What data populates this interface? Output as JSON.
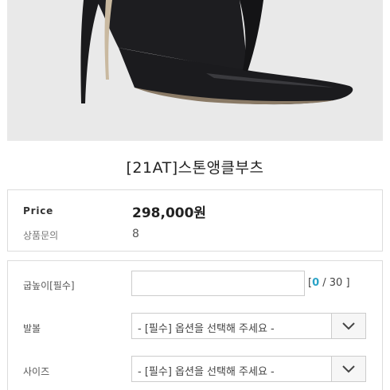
{
  "product": {
    "title": "[21AT]스톤앵클부츠",
    "image_name": "black-stiletto-ankle-boot"
  },
  "info": {
    "price_label": "Price",
    "price_value": "298,000원",
    "qna_label": "상품문의",
    "qna_value": "8"
  },
  "options": {
    "heel_label": "굽높이[필수]",
    "heel_input_value": "",
    "counter_open": "[",
    "counter_current": "0",
    "counter_sep": " / 30 ]",
    "ballbo_label": "발볼",
    "ballbo_select": "- [필수] 옵션을 선택해 주세요 -",
    "size_label": "사이즈",
    "size_select": "- [필수] 옵션을 선택해 주세요 -"
  },
  "icons": {
    "dropdown": "chevron-down-icon"
  },
  "colors": {
    "counter_accent": "#2aa3c7",
    "image_background": "#e8e8e8",
    "boot": "#1c1c1e"
  }
}
